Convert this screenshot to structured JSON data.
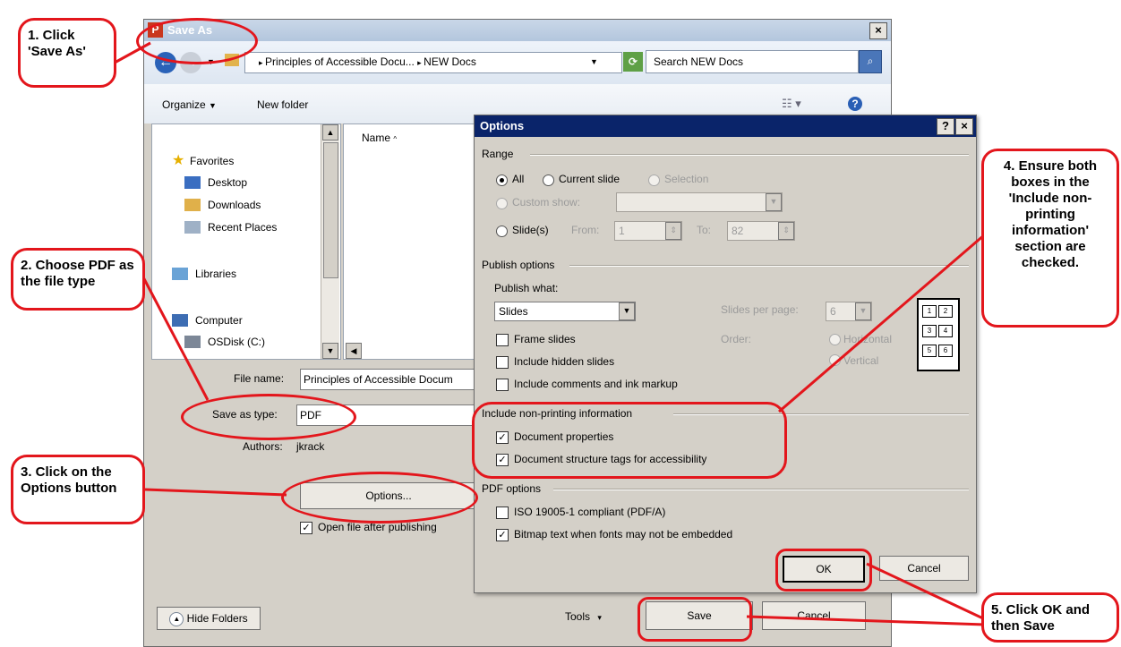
{
  "save_as": {
    "title": "Save As",
    "address_segments": [
      "Principles of Accessible Docu...",
      "NEW Docs"
    ],
    "search_placeholder": "Search NEW Docs",
    "toolbar": {
      "organize": "Organize",
      "new_folder": "New folder"
    },
    "nav": {
      "favorites": "Favorites",
      "desktop": "Desktop",
      "downloads": "Downloads",
      "recent_places": "Recent Places",
      "libraries": "Libraries",
      "computer": "Computer",
      "osdisk": "OSDisk (C:)"
    },
    "list_header": "Name",
    "file_name_label": "File name:",
    "file_name_value": "Principles of Accessible Docum",
    "save_type_label": "Save as type:",
    "save_type_value": "PDF",
    "authors_label": "Authors:",
    "authors_value": "jkrack",
    "options_button": "Options...",
    "open_after_publishing": "Open file after publishing",
    "hide_folders": "Hide Folders",
    "tools": "Tools",
    "save": "Save",
    "cancel": "Cancel"
  },
  "options_dialog": {
    "title": "Options",
    "help_btn": "?",
    "close_btn": "×",
    "range_label": "Range",
    "range_all": "All",
    "range_current": "Current slide",
    "range_selection": "Selection",
    "range_custom": "Custom show:",
    "range_slides": "Slide(s)",
    "from_label": "From:",
    "from_value": "1",
    "to_label": "To:",
    "to_value": "82",
    "publish_options_label": "Publish options",
    "publish_what_label": "Publish what:",
    "publish_what_value": "Slides",
    "slides_per_page_label": "Slides per page:",
    "slides_per_page_value": "6",
    "order_label": "Order:",
    "order_horizontal": "Horizontal",
    "order_vertical": "Vertical",
    "frame_slides": "Frame slides",
    "include_hidden": "Include hidden slides",
    "include_comments": "Include comments and ink markup",
    "nonprinting_label": "Include non-printing information",
    "doc_properties": "Document properties",
    "doc_structure": "Document structure tags for accessibility",
    "pdf_options_label": "PDF options",
    "iso": "ISO 19005-1 compliant (PDF/A)",
    "bitmap": "Bitmap text when fonts may not be embedded",
    "ok": "OK",
    "cancel": "Cancel",
    "grid_nums": [
      "1",
      "2",
      "3",
      "4",
      "5",
      "6"
    ]
  },
  "callouts": {
    "c1": "1. Click 'Save As'",
    "c2": "2. Choose PDF as the file type",
    "c3": "3. Click on the Options button",
    "c4": "4. Ensure both boxes in the 'Include non-printing information' section are checked.",
    "c5": "5. Click OK and then Save"
  },
  "colors": {
    "callout_red": "#e3161c",
    "dialog_title_blue": "#0a246a"
  }
}
